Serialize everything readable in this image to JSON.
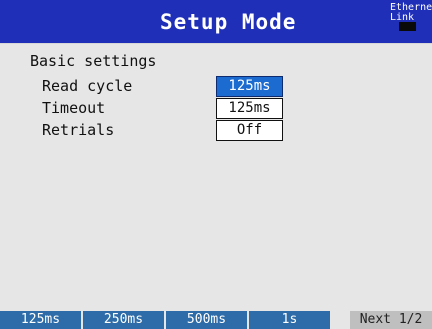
{
  "header": {
    "title": "Setup Mode",
    "status_line1": "Ethernet",
    "status_line2": "Link"
  },
  "settings": {
    "section_title": "Basic settings",
    "rows": [
      {
        "label": "Read cycle",
        "value": "125ms",
        "selected": true
      },
      {
        "label": "Timeout",
        "value": "125ms",
        "selected": false
      },
      {
        "label": "Retrials",
        "value": "Off",
        "selected": false
      }
    ]
  },
  "softkeys": [
    {
      "label": "125ms"
    },
    {
      "label": "250ms"
    },
    {
      "label": "500ms"
    },
    {
      "label": "1s"
    },
    {
      "label": "Next 1/2"
    }
  ],
  "colors": {
    "title_bar": "#1f2fb8",
    "selected_field": "#1b6bd0",
    "softkey": "#2d6ca8",
    "background": "#e6e6e6"
  }
}
